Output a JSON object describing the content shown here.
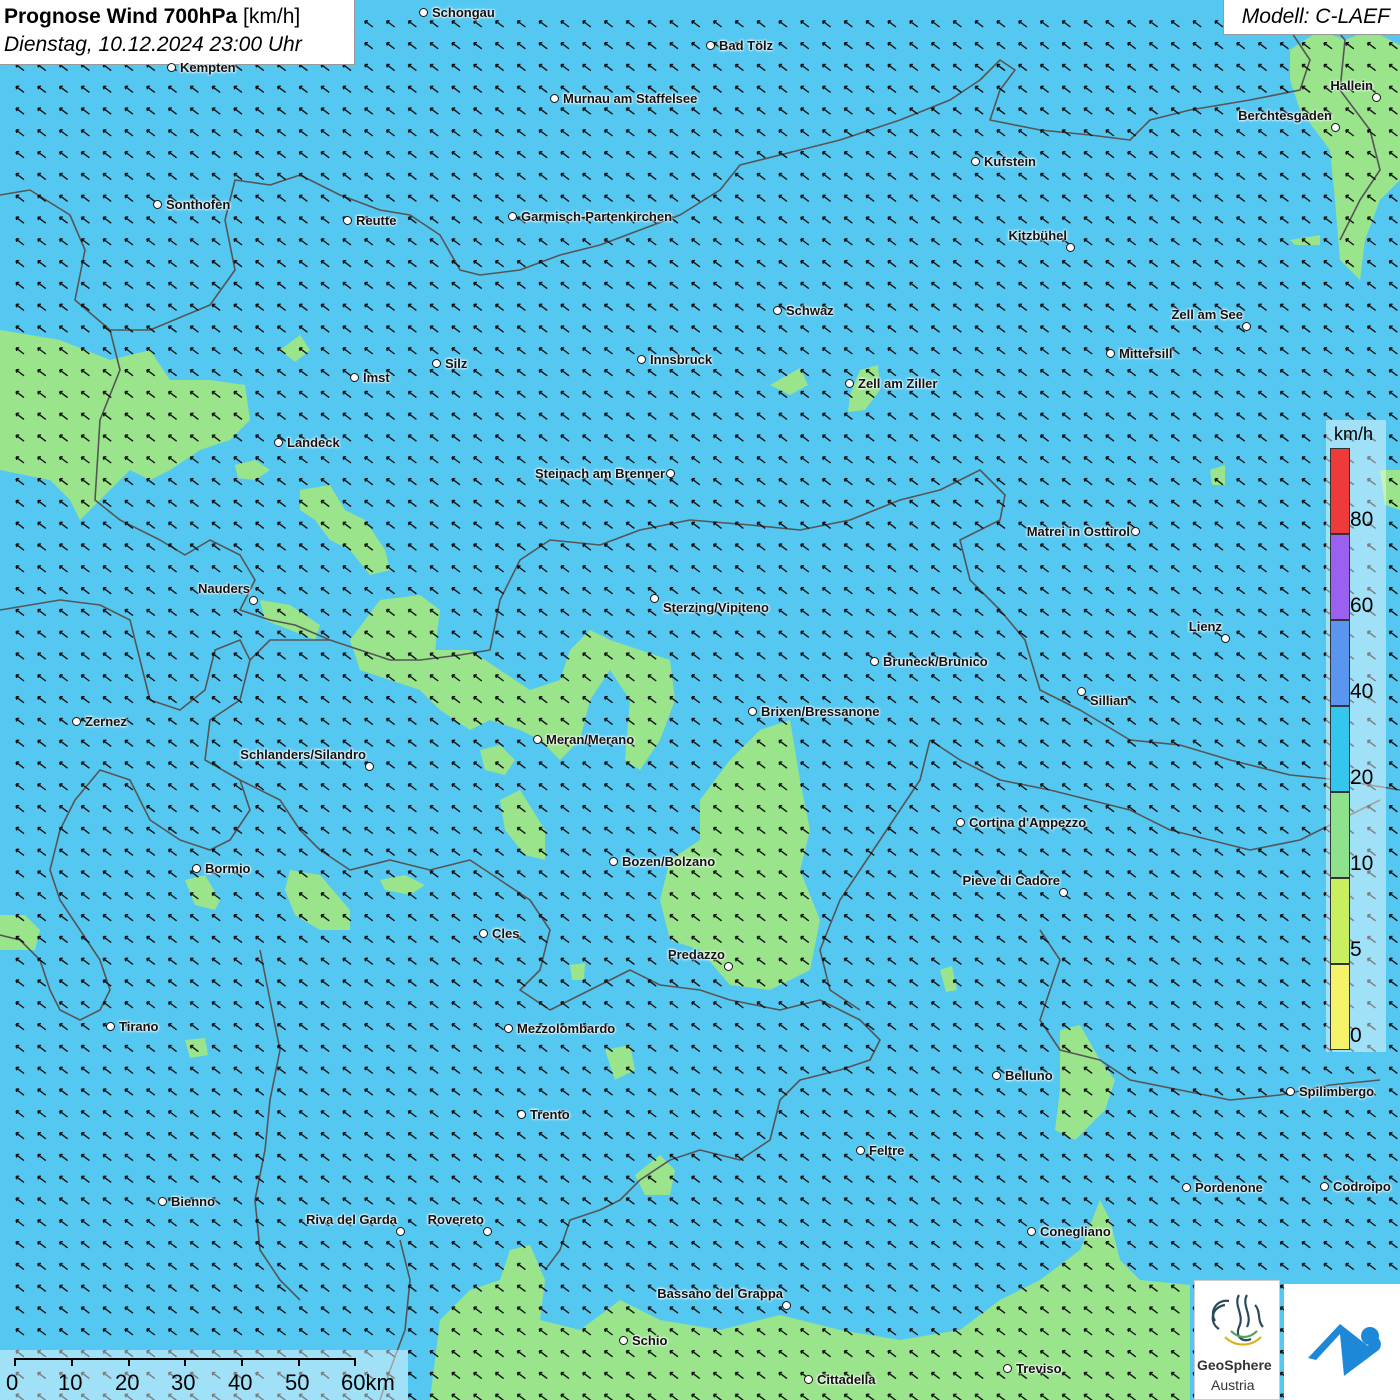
{
  "header": {
    "title_bold": "Prognose Wind 700hPa",
    "title_unit": "[km/h]",
    "datetime": "Dienstag, 10.12.2024 23:00 Uhr",
    "model": "Modell: C-LAEF"
  },
  "legend": {
    "unit": "km/h",
    "labels": [
      "80",
      "60",
      "40",
      "20",
      "10",
      "5",
      "0"
    ],
    "colors": {
      "0_5": "#f4f36a",
      "5_10": "#c9ee5e",
      "10_20": "#8fe28c",
      "20_40": "#35c6ee",
      "40_60": "#5896f0",
      "60_80": "#9a60f0",
      "80_plus": "#ee3a3a"
    }
  },
  "colors": {
    "background_wind": "#55c8f2",
    "light_wind": "#9ae48c",
    "borders": "#555555",
    "arrows": "#111111"
  },
  "wind_field": {
    "direction": "from south-east (arrows pointing north-west)",
    "speed_range": "10-40 km/h"
  },
  "scale_bar": {
    "labels": [
      "0",
      "10",
      "20",
      "30",
      "40",
      "50",
      "60km"
    ]
  },
  "cities": [
    {
      "name": "Schongau"
    },
    {
      "name": "Bad Tölz"
    },
    {
      "name": "Kempten"
    },
    {
      "name": "Murnau am Staffelsee"
    },
    {
      "name": "Hallein"
    },
    {
      "name": "Berchtesgaden"
    },
    {
      "name": "Kufstein"
    },
    {
      "name": "Sonthofen"
    },
    {
      "name": "Reutte"
    },
    {
      "name": "Garmisch-Partenkirchen"
    },
    {
      "name": "Kitzbühel"
    },
    {
      "name": "Schwaz"
    },
    {
      "name": "Zell am See"
    },
    {
      "name": "Mittersill"
    },
    {
      "name": "Innsbruck"
    },
    {
      "name": "Silz"
    },
    {
      "name": "Imst"
    },
    {
      "name": "Zell am Ziller"
    },
    {
      "name": "Landeck"
    },
    {
      "name": "Steinach am Brenner"
    },
    {
      "name": "Matrei in Osttirol"
    },
    {
      "name": "Nauders"
    },
    {
      "name": "Sterzing/Vipiteno"
    },
    {
      "name": "Lienz"
    },
    {
      "name": "Bruneck/Brunico"
    },
    {
      "name": "Sillian"
    },
    {
      "name": "Brixen/Bressanone"
    },
    {
      "name": "Zernez"
    },
    {
      "name": "Meran/Merano"
    },
    {
      "name": "Schlanders/Silandro"
    },
    {
      "name": "Cortina d'Ampezzo"
    },
    {
      "name": "Bozen/Bolzano"
    },
    {
      "name": "Bormio"
    },
    {
      "name": "Pieve di Cadore"
    },
    {
      "name": "Cles"
    },
    {
      "name": "Predazzo"
    },
    {
      "name": "Tirano"
    },
    {
      "name": "Mezzolombardo"
    },
    {
      "name": "Belluno"
    },
    {
      "name": "Spilimbergo"
    },
    {
      "name": "Trento"
    },
    {
      "name": "Feltre"
    },
    {
      "name": "Pordenone"
    },
    {
      "name": "Codroipo"
    },
    {
      "name": "Bienno"
    },
    {
      "name": "Riva del Garda"
    },
    {
      "name": "Rovereto"
    },
    {
      "name": "Conegliano"
    },
    {
      "name": "Bassano del Grappa"
    },
    {
      "name": "Schio"
    },
    {
      "name": "Treviso"
    },
    {
      "name": "Cittadella"
    }
  ],
  "logos": {
    "geosphere_line1": "GeoSphere",
    "geosphere_line2": "Austria"
  }
}
